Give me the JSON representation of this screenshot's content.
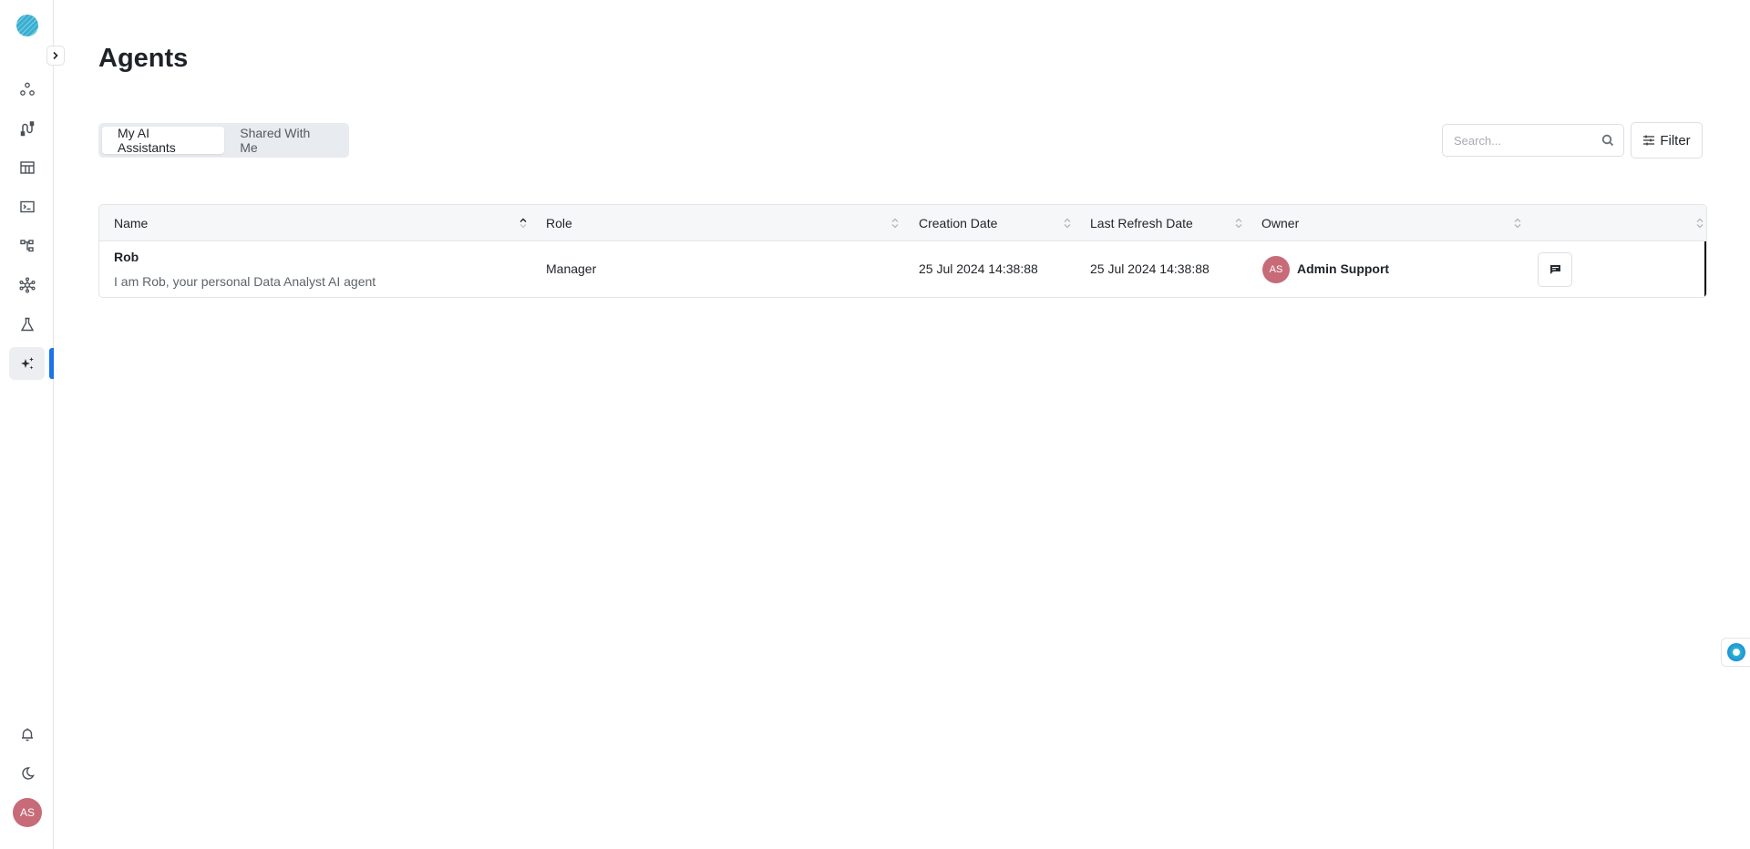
{
  "sidebar": {
    "collapse_icon": "chevron-right-icon",
    "items": [
      {
        "name": "nodes",
        "icon": "graph-nodes-icon"
      },
      {
        "name": "pipelines",
        "icon": "pipeline-icon"
      },
      {
        "name": "tables",
        "icon": "table-icon"
      },
      {
        "name": "terminal",
        "icon": "terminal-icon"
      },
      {
        "name": "hierarchy",
        "icon": "hierarchy-icon"
      },
      {
        "name": "network",
        "icon": "network-icon"
      },
      {
        "name": "lab",
        "icon": "flask-icon"
      },
      {
        "name": "agents",
        "icon": "sparkles-icon",
        "active": true
      }
    ],
    "bottom": {
      "notifications_icon": "bell-icon",
      "theme_icon": "moon-icon",
      "user_initials": "AS"
    }
  },
  "page": {
    "title": "Agents"
  },
  "tabs": [
    {
      "label": "My AI Assistants",
      "active": true
    },
    {
      "label": "Shared With Me",
      "active": false
    }
  ],
  "search": {
    "placeholder": "Search...",
    "value": ""
  },
  "filter": {
    "label": "Filter"
  },
  "table": {
    "columns": [
      {
        "label": "Name",
        "sort": "ascending"
      },
      {
        "label": "Role",
        "sort": "none"
      },
      {
        "label": "Creation Date",
        "sort": "none"
      },
      {
        "label": "Last Refresh Date",
        "sort": "none"
      },
      {
        "label": "Owner",
        "sort": "none"
      },
      {
        "label": "",
        "sort": "none"
      }
    ],
    "rows": [
      {
        "name": "Rob",
        "description": "I am Rob, your personal Data Analyst AI agent",
        "role": "Manager",
        "creation_date": "25 Jul 2024 14:38:88",
        "last_refresh_date": "25 Jul 2024 14:38:88",
        "owner_initials": "AS",
        "owner_name": "Admin Support",
        "action_icon": "chat-icon"
      }
    ]
  },
  "colors": {
    "accent": "#1a73e8",
    "avatar": "#c76b78",
    "logo": "#3aaed0"
  }
}
